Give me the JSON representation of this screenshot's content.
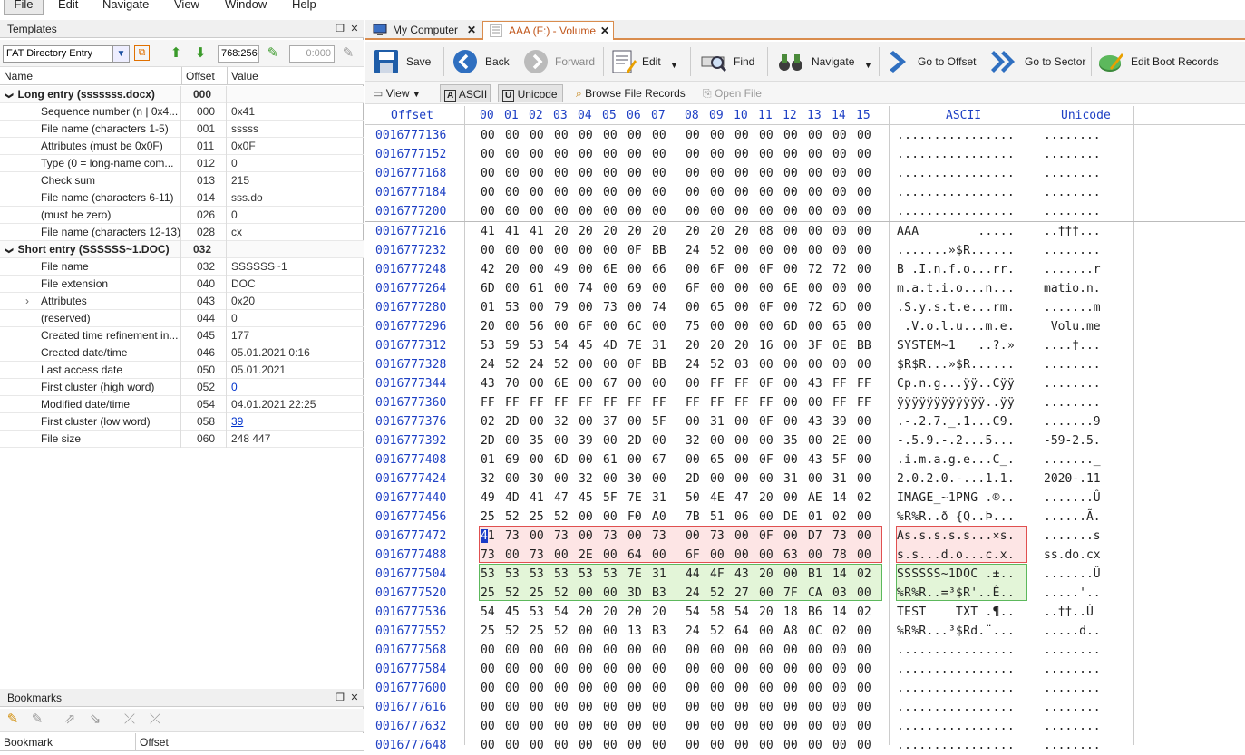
{
  "menu": [
    "File",
    "Edit",
    "Navigate",
    "View",
    "Window",
    "Help"
  ],
  "templates": {
    "title": "Templates",
    "template": "FAT Directory Entry",
    "pos": "768:256",
    "pos2": "0:000",
    "columns": [
      "Name",
      "Offset",
      "Value"
    ],
    "rows": [
      {
        "name": "Long entry (sssssss.docx)",
        "offset": "000",
        "value": "",
        "group": true
      },
      {
        "name": "Sequence number (n | 0x4...",
        "offset": "000",
        "value": "0x41"
      },
      {
        "name": "File name (characters 1-5)",
        "offset": "001",
        "value": "sssss"
      },
      {
        "name": "Attributes (must be 0x0F)",
        "offset": "011",
        "value": "0x0F"
      },
      {
        "name": "Type (0 = long-name com...",
        "offset": "012",
        "value": "0"
      },
      {
        "name": "Check sum",
        "offset": "013",
        "value": "215"
      },
      {
        "name": "File name (characters 6-11)",
        "offset": "014",
        "value": "sss.do"
      },
      {
        "name": "(must be zero)",
        "offset": "026",
        "value": "0"
      },
      {
        "name": "File name (characters 12-13)",
        "offset": "028",
        "value": "cx"
      },
      {
        "name": "Short entry (SSSSSS~1.DOC)",
        "offset": "032",
        "value": "",
        "group": true
      },
      {
        "name": "File name",
        "offset": "032",
        "value": "SSSSSS~1"
      },
      {
        "name": "File extension",
        "offset": "040",
        "value": "DOC"
      },
      {
        "name": "Attributes",
        "offset": "043",
        "value": "0x20",
        "expand": true
      },
      {
        "name": "(reserved)",
        "offset": "044",
        "value": "0"
      },
      {
        "name": "Created time refinement in...",
        "offset": "045",
        "value": "177"
      },
      {
        "name": "Created date/time",
        "offset": "046",
        "value": "05.01.2021 0:16"
      },
      {
        "name": "Last access date",
        "offset": "050",
        "value": "05.01.2021"
      },
      {
        "name": "First cluster (high word)",
        "offset": "052",
        "value": "0",
        "link": true
      },
      {
        "name": "Modified date/time",
        "offset": "054",
        "value": "04.01.2021 22:25"
      },
      {
        "name": "First cluster (low word)",
        "offset": "058",
        "value": "39",
        "link": true
      },
      {
        "name": "File size",
        "offset": "060",
        "value": "248 447"
      }
    ]
  },
  "bookmarks": {
    "title": "Bookmarks",
    "columns": [
      "Bookmark",
      "Offset"
    ]
  },
  "tabs": [
    {
      "label": "My Computer"
    },
    {
      "label": "AAA (F:) - Volume",
      "active": true
    }
  ],
  "toolbar": {
    "save": "Save",
    "back": "Back",
    "forward": "Forward",
    "edit": "Edit",
    "find": "Find",
    "navigate": "Navigate",
    "goto_offset": "Go to Offset",
    "goto_sector": "Go to Sector",
    "edit_boot": "Edit Boot Records"
  },
  "toolbar2": {
    "view": "View",
    "ascii": "ASCII",
    "unicode": "Unicode",
    "browse": "Browse File Records",
    "open": "Open File"
  },
  "hex": {
    "offset_label": "Offset",
    "ascii_label": "ASCII",
    "unicode_label": "Unicode",
    "cols": [
      "00",
      "01",
      "02",
      "03",
      "04",
      "05",
      "06",
      "07",
      "08",
      "09",
      "10",
      "11",
      "12",
      "13",
      "14",
      "15"
    ],
    "rows": [
      {
        "o": "0016777136",
        "h": "00 00 00 00 00 00 00 00 00 00 00 00 00 00 00 00",
        "a": "................",
        "u": "........"
      },
      {
        "o": "0016777152",
        "h": "00 00 00 00 00 00 00 00 00 00 00 00 00 00 00 00",
        "a": "................",
        "u": "........"
      },
      {
        "o": "0016777168",
        "h": "00 00 00 00 00 00 00 00 00 00 00 00 00 00 00 00",
        "a": "................",
        "u": "........"
      },
      {
        "o": "0016777184",
        "h": "00 00 00 00 00 00 00 00 00 00 00 00 00 00 00 00",
        "a": "................",
        "u": "........"
      },
      {
        "o": "0016777200",
        "h": "00 00 00 00 00 00 00 00 00 00 00 00 00 00 00 00",
        "a": "................",
        "u": "........"
      },
      {
        "o": "0016777216",
        "h": "41 41 41 20 20 20 20 20 20 20 20 08 00 00 00 00",
        "a": "AAA        .....",
        "u": "..†††..."
      },
      {
        "o": "0016777232",
        "h": "00 00 00 00 00 00 0F BB 24 52 00 00 00 00 00 00",
        "a": ".......»$R......",
        "u": "........"
      },
      {
        "o": "0016777248",
        "h": "42 20 00 49 00 6E 00 66 00 6F 00 0F 00 72 72 00",
        "a": "B .I.n.f.o...rr.",
        "u": ".......r"
      },
      {
        "o": "0016777264",
        "h": "6D 00 61 00 74 00 69 00 6F 00 00 00 6E 00 00 00",
        "a": "m.a.t.i.o...n...",
        "u": "matio.n."
      },
      {
        "o": "0016777280",
        "h": "01 53 00 79 00 73 00 74 00 65 00 0F 00 72 6D 00",
        "a": ".S.y.s.t.e...rm.",
        "u": ".......m"
      },
      {
        "o": "0016777296",
        "h": "20 00 56 00 6F 00 6C 00 75 00 00 00 6D 00 65 00",
        "a": " .V.o.l.u...m.e.",
        "u": " Volu.me"
      },
      {
        "o": "0016777312",
        "h": "53 59 53 54 45 4D 7E 31 20 20 20 16 00 3F 0E BB",
        "a": "SYSTEM~1   ..?.»",
        "u": "....†..."
      },
      {
        "o": "0016777328",
        "h": "24 52 24 52 00 00 0F BB 24 52 03 00 00 00 00 00",
        "a": "$R$R...»$R......",
        "u": "........"
      },
      {
        "o": "0016777344",
        "h": "43 70 00 6E 00 67 00 00 00 FF FF 0F 00 43 FF FF",
        "a": "Cp.n.g...ÿÿ..Cÿÿ",
        "u": "........"
      },
      {
        "o": "0016777360",
        "h": "FF FF FF FF FF FF FF FF FF FF FF FF 00 00 FF FF",
        "a": "ÿÿÿÿÿÿÿÿÿÿÿÿ..ÿÿ",
        "u": "........"
      },
      {
        "o": "0016777376",
        "h": "02 2D 00 32 00 37 00 5F 00 31 00 0F 00 43 39 00",
        "a": ".-.2.7._.1...C9.",
        "u": ".......9"
      },
      {
        "o": "0016777392",
        "h": "2D 00 35 00 39 00 2D 00 32 00 00 00 35 00 2E 00",
        "a": "-.5.9.-.2...5...",
        "u": "-59-2.5."
      },
      {
        "o": "0016777408",
        "h": "01 69 00 6D 00 61 00 67 00 65 00 0F 00 43 5F 00",
        "a": ".i.m.a.g.e...C_.",
        "u": "......._"
      },
      {
        "o": "0016777424",
        "h": "32 00 30 00 32 00 30 00 2D 00 00 00 31 00 31 00",
        "a": "2.0.2.0.-...1.1.",
        "u": "2020-.11"
      },
      {
        "o": "0016777440",
        "h": "49 4D 41 47 45 5F 7E 31 50 4E 47 20 00 AE 14 02",
        "a": "IMAGE_~1PNG .®..",
        "u": ".......Û"
      },
      {
        "o": "0016777456",
        "h": "25 52 25 52 00 00 F0 A0 7B 51 06 00 DE 01 02 00",
        "a": "%R%R..ð {Q..Þ...",
        "u": "......Ã."
      },
      {
        "o": "0016777472",
        "h": "41 73 00 73 00 73 00 73 00 73 00 0F 00 D7 73 00",
        "a": "As.s.s.s.s...×s.",
        "u": ".......s"
      },
      {
        "o": "0016777488",
        "h": "73 00 73 00 2E 00 64 00 6F 00 00 00 63 00 78 00",
        "a": "s.s...d.o...c.x.",
        "u": "ss.do.cx"
      },
      {
        "o": "0016777504",
        "h": "53 53 53 53 53 53 7E 31 44 4F 43 20 00 B1 14 02",
        "a": "SSSSSS~1DOC .±..",
        "u": ".......Û"
      },
      {
        "o": "0016777520",
        "h": "25 52 25 52 00 00 3D B3 24 52 27 00 7F CA 03 00",
        "a": "%R%R..=³$R'..Ê..",
        "u": ".....'.."
      },
      {
        "o": "0016777536",
        "h": "54 45 53 54 20 20 20 20 54 58 54 20 18 B6 14 02",
        "a": "TEST    TXT .¶..",
        "u": "..††..Û"
      },
      {
        "o": "0016777552",
        "h": "25 52 25 52 00 00 13 B3 24 52 64 00 A8 0C 02 00",
        "a": "%R%R...³$Rd.¨...",
        "u": ".....d.."
      },
      {
        "o": "0016777568",
        "h": "00 00 00 00 00 00 00 00 00 00 00 00 00 00 00 00",
        "a": "................",
        "u": "........"
      },
      {
        "o": "0016777584",
        "h": "00 00 00 00 00 00 00 00 00 00 00 00 00 00 00 00",
        "a": "................",
        "u": "........"
      },
      {
        "o": "0016777600",
        "h": "00 00 00 00 00 00 00 00 00 00 00 00 00 00 00 00",
        "a": "................",
        "u": "........"
      },
      {
        "o": "0016777616",
        "h": "00 00 00 00 00 00 00 00 00 00 00 00 00 00 00 00",
        "a": "................",
        "u": "........"
      },
      {
        "o": "0016777632",
        "h": "00 00 00 00 00 00 00 00 00 00 00 00 00 00 00 00",
        "a": "................",
        "u": "........"
      },
      {
        "o": "0016777648",
        "h": "00 00 00 00 00 00 00 00 00 00 00 00 00 00 00 00",
        "a": "................",
        "u": "........"
      }
    ]
  }
}
